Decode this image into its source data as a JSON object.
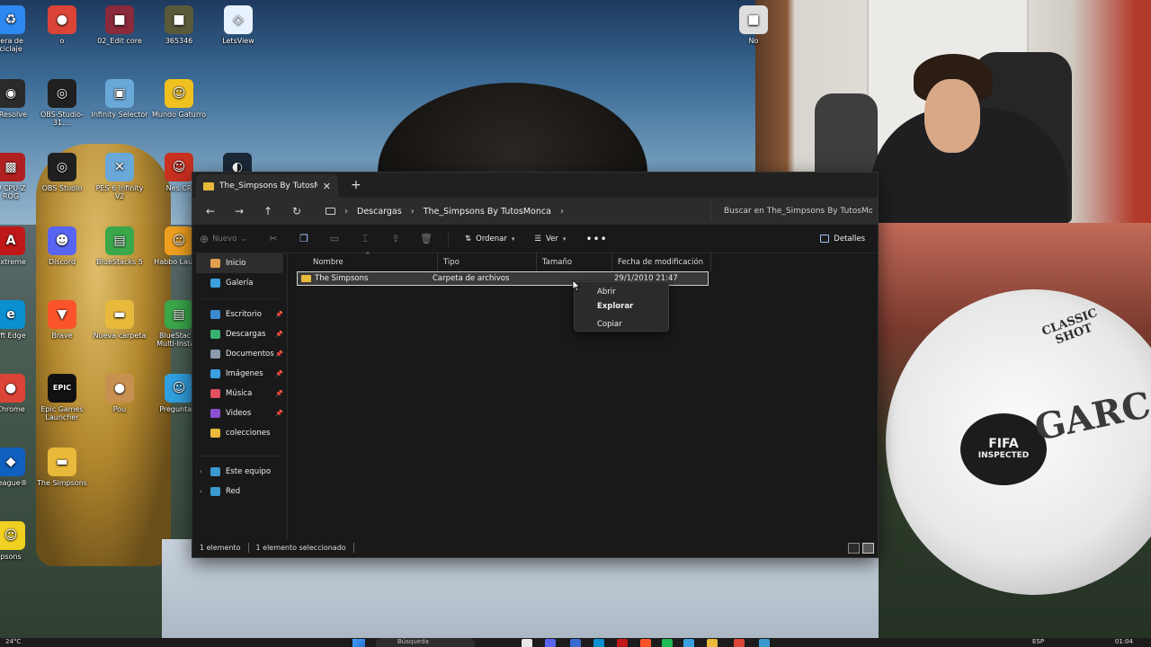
{
  "desktop": {
    "icons": [
      {
        "label": "Papelera de reciclaje",
        "display": "iera de\nciclaje",
        "color": "#2d89ef",
        "glyph": "♻"
      },
      {
        "label": "o",
        "display": "o",
        "color": "#db4437",
        "glyph": "●"
      },
      {
        "label": "02_Edit core",
        "display": "02_Edit core",
        "color": "#8a2a3a",
        "glyph": "■"
      },
      {
        "label": "365346",
        "display": "365346",
        "color": "#5a5a3a",
        "glyph": "■"
      },
      {
        "label": "LetsView",
        "display": "LetsView",
        "color": "#e8f2ff",
        "glyph": "◇"
      },
      {
        "label": "DaVinci Resolve",
        "display": "i Resolve",
        "color": "#2a2a2a",
        "glyph": "◉"
      },
      {
        "label": "OBS-Studio-31....",
        "display": "OBS-Studio-31....",
        "color": "#202020",
        "glyph": "◎"
      },
      {
        "label": "Infinity Selector",
        "display": "Infinity Selector",
        "color": "#6aa8d8",
        "glyph": "▣"
      },
      {
        "label": "Mundo Gaturro",
        "display": "Mundo Gaturro",
        "color": "#f0c020",
        "glyph": "☺"
      },
      {
        "label": "CPU-Z",
        "display": "U CPU-Z\nROG",
        "color": "#b02020",
        "glyph": "▩"
      },
      {
        "label": "OBS Studio",
        "display": "OBS Studio",
        "color": "#202020",
        "glyph": "◎"
      },
      {
        "label": "PES 6 Infinity V2",
        "display": "PES 6 Infinity V2",
        "color": "#6aa8d8",
        "glyph": "✕"
      },
      {
        "label": "Nes.CR",
        "display": "Nes.CR",
        "color": "#c83020",
        "glyph": "☺"
      },
      {
        "label": "Steam",
        "display": "",
        "color": "#1b2838",
        "glyph": "◐"
      },
      {
        "label": "Extreme",
        "display": "Extreme",
        "color": "#c01818",
        "glyph": "A"
      },
      {
        "label": "Discord",
        "display": "Discord",
        "color": "#5865f2",
        "glyph": "☻"
      },
      {
        "label": "BlueStacks 5",
        "display": "BlueStacks 5",
        "color": "#3aa84a",
        "glyph": "▤"
      },
      {
        "label": "Habbo Launcher",
        "display": "Habbo Laun...",
        "color": "#f0a020",
        "glyph": "☺"
      },
      {
        "label": "Microsoft Edge",
        "display": "oft Edge",
        "color": "#0a8fd0",
        "glyph": "e"
      },
      {
        "label": "Brave",
        "display": "Brave",
        "color": "#fb542b",
        "glyph": "▼"
      },
      {
        "label": "Nueva carpeta",
        "display": "Nueva carpeta",
        "color": "#e8b93a",
        "glyph": "▬"
      },
      {
        "label": "BlueStacks Multi-Instance",
        "display": "BlueStacks\nMulti-Insta...",
        "color": "#3aa84a",
        "glyph": "▤"
      },
      {
        "label": "Chrome",
        "display": "Chrome",
        "color": "#db4437",
        "glyph": "●"
      },
      {
        "label": "Epic Games Launcher",
        "display": "Epic Games\nLauncher",
        "color": "#111111",
        "glyph": "EPIC"
      },
      {
        "label": "Pou",
        "display": "Pou",
        "color": "#c89050",
        "glyph": "●"
      },
      {
        "label": "Preguntados",
        "display": "Pregunta...",
        "color": "#30a0e0",
        "glyph": "☺"
      },
      {
        "label": "Rocket League",
        "display": "League®",
        "color": "#1060c0",
        "glyph": "◆"
      },
      {
        "label": "The Simpsons",
        "display": "The Simpsons",
        "color": "#e8b93a",
        "glyph": "▬"
      },
      {
        "label": "Simpsons",
        "display": "psons",
        "color": "#f0d020",
        "glyph": "☺"
      },
      {
        "label": "No",
        "display": "No",
        "color": "#dddddd",
        "glyph": "■"
      }
    ]
  },
  "wallpaper": {
    "ball_badge_line1": "FIFA",
    "ball_badge_line2": "INSPECTED",
    "ball_text": "GARC",
    "ball_top_line1": "CLASSIC",
    "ball_top_line2": "SHOT"
  },
  "explorer": {
    "tab_title": "The_Simpsons By TutosMonca",
    "tab_close": "✕",
    "tab_add": "+",
    "nav": {
      "back": "←",
      "forward": "→",
      "up": "↑",
      "refresh": "↻"
    },
    "breadcrumbs": [
      "Descargas",
      "The_Simpsons By TutosMonca"
    ],
    "search_placeholder": "Buscar en The_Simpsons By TutosMonca",
    "toolbar": {
      "new_label": "Nuevo",
      "sort_label": "Ordenar",
      "view_label": "Ver",
      "more_label": "•••",
      "details_label": "Detalles"
    },
    "sidebar": {
      "items": [
        {
          "label": "Inicio",
          "color": "#e0a050",
          "pinned": false
        },
        {
          "label": "Galería",
          "color": "#3aa0e0",
          "pinned": false
        },
        {
          "label": "Escritorio",
          "color": "#3a8ad0",
          "pinned": true
        },
        {
          "label": "Descargas",
          "color": "#3ab070",
          "pinned": true
        },
        {
          "label": "Documentos",
          "color": "#8a9aaa",
          "pinned": true
        },
        {
          "label": "Imágenes",
          "color": "#3aa0e0",
          "pinned": true
        },
        {
          "label": "Música",
          "color": "#e05060",
          "pinned": true
        },
        {
          "label": "Videos",
          "color": "#8a50d0",
          "pinned": true
        },
        {
          "label": "colecciones",
          "color": "#e8b93a",
          "pinned": false
        },
        {
          "label": "Este equipo",
          "color": "#3a9ad0",
          "pinned": false
        },
        {
          "label": "Red",
          "color": "#3a9ad0",
          "pinned": false
        }
      ]
    },
    "columns": [
      "Nombre",
      "Tipo",
      "Tamaño",
      "Fecha de modificación"
    ],
    "files": [
      {
        "name": "The Simpsons",
        "type": "Carpeta de archivos",
        "size": "",
        "modified": "29/1/2010 21:47"
      }
    ],
    "context_menu": [
      {
        "label": "Abrir",
        "bold": false
      },
      {
        "label": "Explorar",
        "bold": true
      },
      {
        "label": "Copiar",
        "bold": false
      }
    ],
    "status": {
      "count": "1 elemento",
      "selected": "1 elemento seleccionado"
    }
  },
  "taskbar": {
    "weather": "24°C",
    "search_label": "Búsqueda",
    "language": "ESP",
    "time": "01:04"
  }
}
